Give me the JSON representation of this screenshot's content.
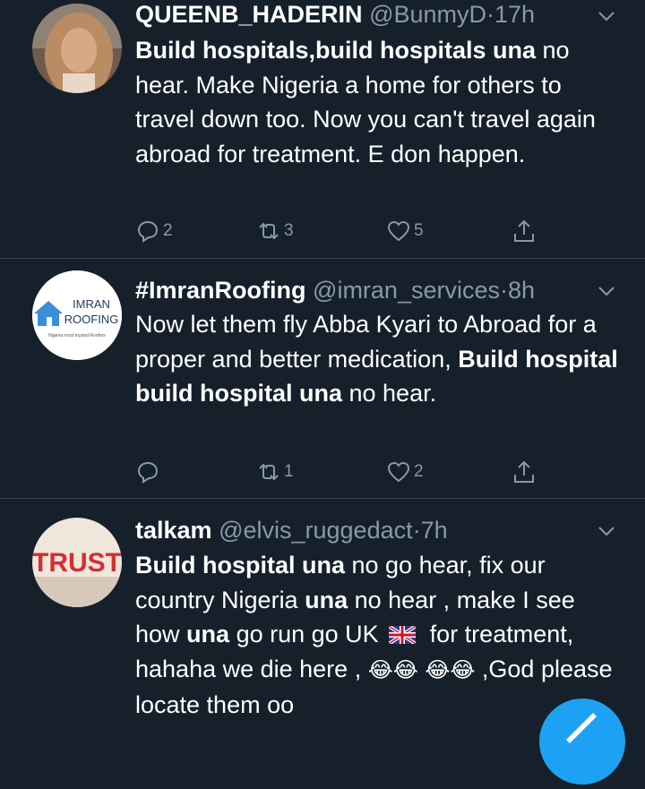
{
  "tweets": [
    {
      "name": "QUEENB_HADERIN",
      "handle": "@BunmyD",
      "dot": "·",
      "time": "17h",
      "text": [
        {
          "b": "Build hospitals,build hospitals una"
        },
        {
          "t": " no hear. Make Nigeria a home for others to travel down too. Now you can't travel again abroad for treatment. E don happen."
        }
      ],
      "replies": "2",
      "retweets": "3",
      "likes": "5"
    },
    {
      "name": "#ImranRoofing",
      "handle": "@imran_services",
      "dot": "·",
      "time": "8h",
      "avatar_logo": {
        "line1": "IMRAN",
        "line2": "ROOFING",
        "tagline": "Nigeria most trusted Roofers"
      },
      "text": [
        {
          "t": "Now let them fly Abba Kyari to Abroad for a proper and better medication, "
        },
        {
          "b": "Build hospital build hospital una"
        },
        {
          "t": " no hear."
        }
      ],
      "replies": "",
      "retweets": "1",
      "likes": "2"
    },
    {
      "name": "talkam",
      "handle": "@elvis_ruggedact",
      "dot": "·",
      "time": "7h",
      "avatar_logo": {
        "word": "TRUST"
      },
      "text": [
        {
          "b": "Build hospital una"
        },
        {
          "t": " no go hear, fix our country Nigeria "
        },
        {
          "b": "una"
        },
        {
          "t": "  no hear , make I see how "
        },
        {
          "b": "una"
        },
        {
          "t": " go run go UK "
        },
        {
          "flag": "UK"
        },
        {
          "t": " for treatment, hahaha we die here , "
        },
        {
          "e": "😂😂"
        },
        {
          "t": " "
        },
        {
          "e": "😂😂"
        },
        {
          "t": " ,God please locate them oo"
        }
      ]
    }
  ],
  "icons": {
    "reply": "reply-icon",
    "retweet": "retweet-icon",
    "like": "heart-icon",
    "share": "share-icon",
    "more": "chevron-down-icon",
    "compose": "compose-icon"
  },
  "colors": {
    "background": "#15202b",
    "secondary": "#8899a6",
    "divider": "#38444d",
    "accent": "#1da1f2"
  }
}
